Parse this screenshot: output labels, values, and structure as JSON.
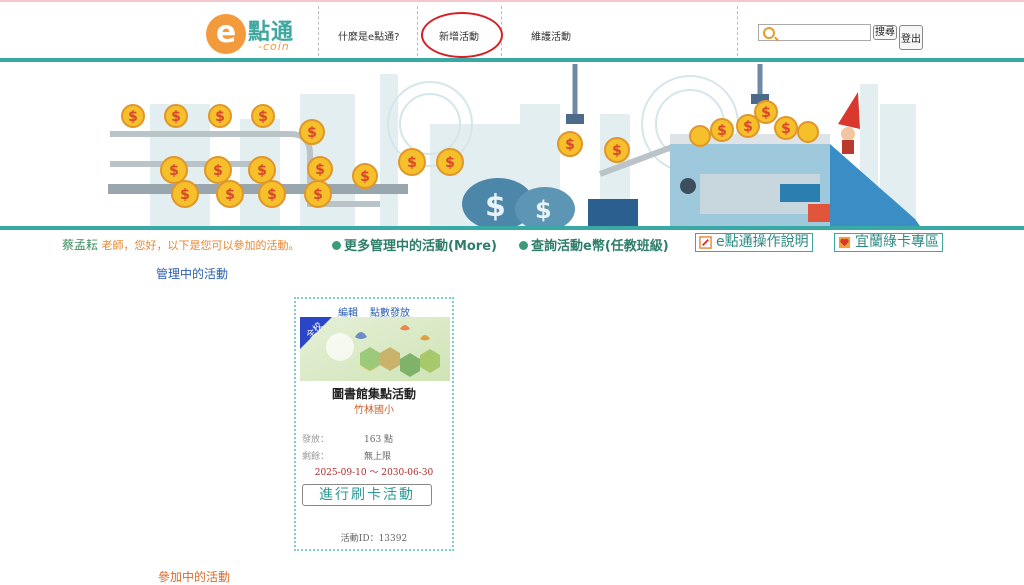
{
  "logo": {
    "letter": "e",
    "text": "點通",
    "sub": "-coin"
  },
  "nav": {
    "items": [
      {
        "label": "什麼是e點通?"
      },
      {
        "label": "新增活動"
      },
      {
        "label": "維護活動"
      }
    ],
    "search_placeholder": "",
    "search_button": "搜尋",
    "logout_button": "登出"
  },
  "info_bar": {
    "user_name": "蔡孟耘",
    "greeting": " 老師，您好，以下是您可以參加的活動。",
    "link_more": "更多管理中的活動(More)",
    "link_query": "查詢活動e幣(任教班級)",
    "help_operation": "e點通操作說明",
    "help_greencard": "宜蘭綠卡專區"
  },
  "sections": {
    "managing": "管理中的活動",
    "participating": "參加中的活動"
  },
  "card": {
    "edit": "編輯",
    "issue_points": "點數發放",
    "badge": "全校",
    "title": "圖書館集點活動",
    "school": "竹林國小",
    "issued_label": "發放：",
    "issued_value": "163 點",
    "remaining_label": "剩餘：",
    "remaining_value": "無上限",
    "dates": "2025-09-10 ～ 2030-06-30",
    "swipe_button": "進行刷卡活動",
    "activity_id": "活動ID：13392"
  },
  "colors": {
    "accent_teal": "#38a9a4",
    "brand_orange": "#f39a3c",
    "highlight_red": "#d61f26",
    "section_blue": "#2a5db0",
    "section_orange": "#d96a2a"
  }
}
